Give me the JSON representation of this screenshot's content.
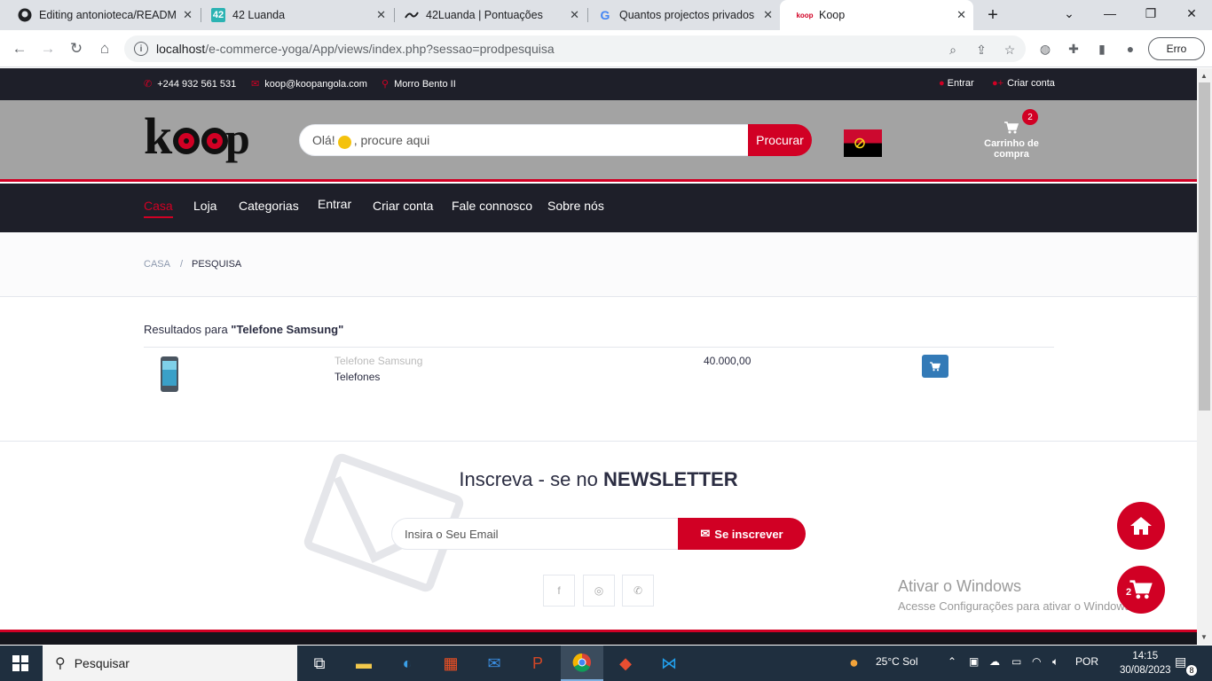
{
  "browser": {
    "tabs": [
      {
        "label": "Editing antonioteca/README",
        "icon": "github-icon"
      },
      {
        "label": "42 Luanda",
        "icon": "42-icon"
      },
      {
        "label": "42Luanda | Pontuações",
        "icon": "42-icon"
      },
      {
        "label": "Quantos projectos privados c",
        "icon": "google-icon"
      },
      {
        "label": "Koop",
        "icon": "koop-icon"
      }
    ],
    "url_host": "localhost",
    "url_path": "/e-commerce-yoga/App/views/index.php?sessao=prodpesquisa",
    "profile_button": "Erro"
  },
  "topbar": {
    "phone": "+244 932 561 531",
    "email": "koop@koopangola.com",
    "location": "Morro Bento II",
    "login": "Entrar",
    "register": "Criar conta"
  },
  "header": {
    "search_placeholder_pre": "Olá!",
    "search_placeholder_post": ",  procure aqui",
    "search_button": "Procurar",
    "cart_label": "Carrinho de compra",
    "cart_count": "2"
  },
  "nav": {
    "items": [
      "Casa",
      "Loja",
      "Categorias",
      "Entrar",
      "Criar conta",
      "Fale connosco",
      "Sobre nós"
    ]
  },
  "breadcrumb": {
    "home": "Casa",
    "sep": "/",
    "current": "Pesquisa"
  },
  "results": {
    "prefix": "Resultados para",
    "query": "\"Telefone Samsung\""
  },
  "product": {
    "name": "Telefone Samsung",
    "category": "Telefones",
    "price": "40.000,00"
  },
  "newsletter": {
    "title_pre": "Inscreva - se no",
    "title_bold": "NEWSLETTER",
    "placeholder": "Insira o Seu Email",
    "button": "Se inscrever"
  },
  "floating": {
    "cart_count": "2"
  },
  "watermark": {
    "line1": "Ativar o Windows",
    "line2": "Acesse Configurações para ativar o Windows."
  },
  "taskbar": {
    "search_label": "Pesquisar",
    "weather": "25°C  Sol",
    "lang": "POR",
    "time": "14:15",
    "date": "30/08/2023",
    "notif_count": "8"
  },
  "colors": {
    "brand": "#d10024",
    "dark": "#1e1f29",
    "header_bg": "#a3a3a3"
  }
}
